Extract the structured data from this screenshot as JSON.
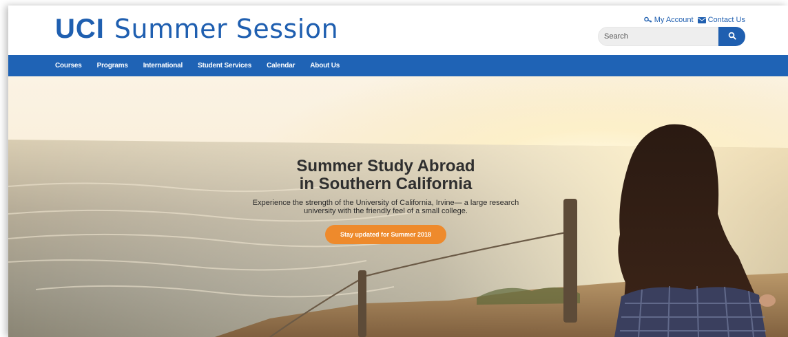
{
  "header": {
    "logo_primary": "UCI",
    "logo_secondary": "Summer Session",
    "my_account": "My Account",
    "contact_us": "Contact Us",
    "search_placeholder": "Search"
  },
  "nav": {
    "items": [
      {
        "label": "Courses"
      },
      {
        "label": "Programs"
      },
      {
        "label": "International"
      },
      {
        "label": "Student Services"
      },
      {
        "label": "Calendar"
      },
      {
        "label": "About Us"
      }
    ]
  },
  "hero": {
    "title_line1": "Summer Study Abroad",
    "title_line2": "in Southern California",
    "subtitle_line1": "Experience the strength of the University of California, Irvine— a large research",
    "subtitle_line2": "university with the friendly feel of a small college.",
    "cta_label": "Stay updated for Summer 2018"
  },
  "colors": {
    "brand_blue": "#1f63b5",
    "cta_orange": "#ee8a2c"
  },
  "icons": {
    "account": "key-icon",
    "contact": "envelope-icon",
    "search": "search-icon"
  }
}
